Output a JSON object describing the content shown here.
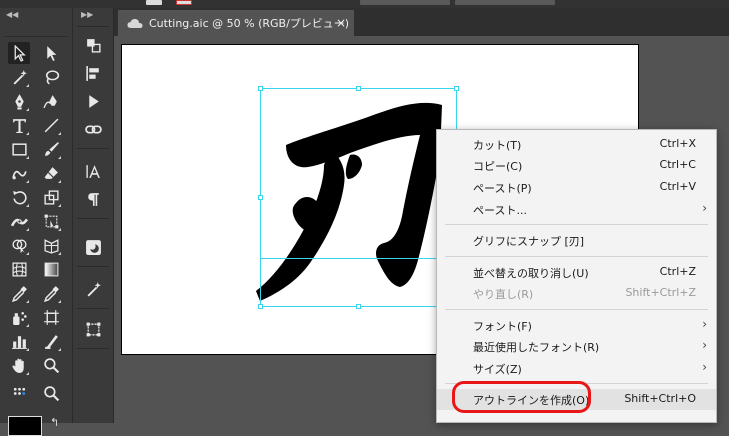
{
  "document_tab": {
    "title": "Cutting.aic @ 50 % (RGB/プレビュー)",
    "close_symbol": "×",
    "cloud_icon": "cloud-icon"
  },
  "artwork": {
    "glyph": "刃",
    "fill_color": "#000000",
    "selection_color": "#38d6ee"
  },
  "toolbar": {
    "tools": [
      "selection-tool-icon",
      "direct-selection-tool-icon",
      "magic-wand-tool-icon",
      "lasso-tool-icon",
      "pen-tool-icon",
      "curvature-tool-icon",
      "type-tool-icon",
      "line-segment-tool-icon",
      "rectangle-tool-icon",
      "paintbrush-tool-icon",
      "shaper-tool-icon",
      "eraser-tool-icon",
      "rotate-tool-icon",
      "scale-tool-icon",
      "width-tool-icon",
      "free-transform-tool-icon",
      "shape-builder-tool-icon",
      "perspective-grid-tool-icon",
      "mesh-tool-icon",
      "gradient-tool-icon",
      "eyedropper-tool-icon",
      "blend-tool-icon",
      "symbol-sprayer-tool-icon",
      "artboard-tool-icon",
      "column-graph-tool-icon",
      "slice-tool-icon",
      "hand-tool-icon",
      "zoom-tool-icon"
    ],
    "fill_swatch": "#000000"
  },
  "context_menu": {
    "highlight_color": "#e81616",
    "items": [
      {
        "label": "カット(T)",
        "shortcut": "Ctrl+X"
      },
      {
        "label": "コピー(C)",
        "shortcut": "Ctrl+C"
      },
      {
        "label": "ペースト(P)",
        "shortcut": "Ctrl+V"
      },
      {
        "label": "ペースト...",
        "submenu": "›"
      },
      {
        "label": "グリフにスナップ [刃]"
      },
      {
        "label": "並べ替えの取り消し(U)",
        "shortcut": "Ctrl+Z"
      },
      {
        "label": "やり直し(R)",
        "shortcut": "Shift+Ctrl+Z"
      },
      {
        "label": "フォント(F)",
        "submenu": "›"
      },
      {
        "label": "最近使用したフォント(R)",
        "submenu": "›"
      },
      {
        "label": "サイズ(Z)",
        "submenu": "›"
      },
      {
        "label": "アウトラインを作成(O)",
        "shortcut": "Shift+Ctrl+O"
      }
    ]
  }
}
